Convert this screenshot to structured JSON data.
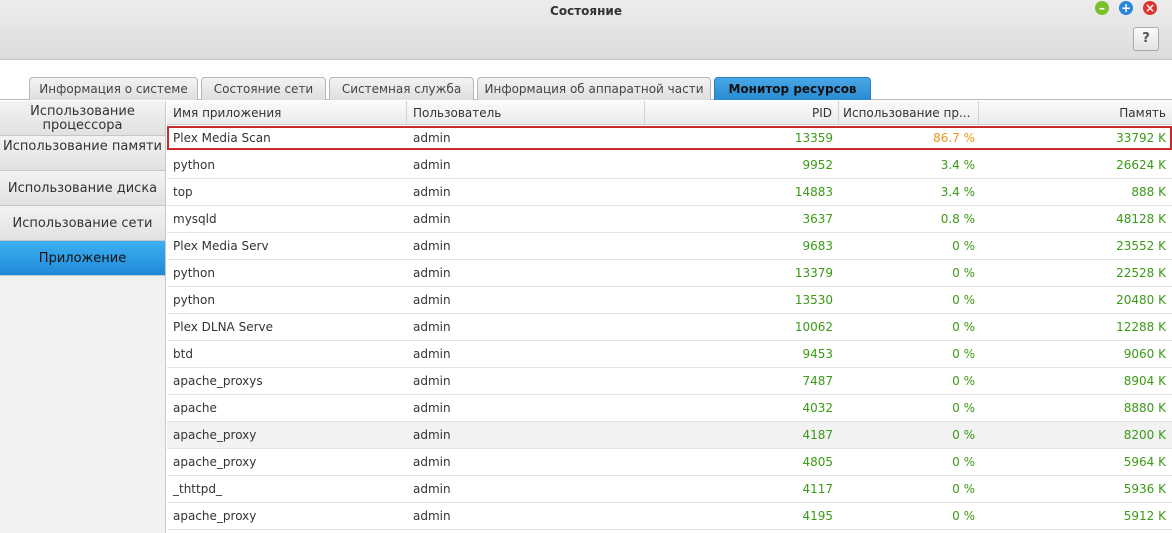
{
  "window": {
    "title": "Состояние",
    "help_label": "?",
    "controls": {
      "minimize": "–",
      "maximize": "+",
      "close": "×"
    }
  },
  "tabs": [
    {
      "label": "Информация о системе",
      "active": false
    },
    {
      "label": "Состояние сети",
      "active": false
    },
    {
      "label": "Системная служба",
      "active": false
    },
    {
      "label": "Информация об аппаратной части",
      "active": false
    },
    {
      "label": "Монитор ресурсов",
      "active": true
    }
  ],
  "sidebar": {
    "items": [
      {
        "label": "Использование процессора",
        "active": false
      },
      {
        "label": "Использование памяти",
        "active": false
      },
      {
        "label": "Использование диска",
        "active": false
      },
      {
        "label": "Использование сети",
        "active": false
      },
      {
        "label": "Приложение",
        "active": true
      }
    ]
  },
  "table": {
    "columns": {
      "name": "Имя приложения",
      "user": "Пользователь",
      "pid": "PID",
      "cpu": "Использование пр...",
      "mem": "Память"
    },
    "rows": [
      {
        "name": "Plex Media Scan",
        "user": "admin",
        "pid": "13359",
        "cpu": "86.7 %",
        "mem": "33792 K",
        "selected": true
      },
      {
        "name": "python",
        "user": "admin",
        "pid": "9952",
        "cpu": "3.4 %",
        "mem": "26624 K"
      },
      {
        "name": "top",
        "user": "admin",
        "pid": "14883",
        "cpu": "3.4 %",
        "mem": "888 K"
      },
      {
        "name": "mysqld",
        "user": "admin",
        "pid": "3637",
        "cpu": "0.8 %",
        "mem": "48128 K"
      },
      {
        "name": "Plex Media Serv",
        "user": "admin",
        "pid": "9683",
        "cpu": "0 %",
        "mem": "23552 K"
      },
      {
        "name": "python",
        "user": "admin",
        "pid": "13379",
        "cpu": "0 %",
        "mem": "22528 K"
      },
      {
        "name": "python",
        "user": "admin",
        "pid": "13530",
        "cpu": "0 %",
        "mem": "20480 K"
      },
      {
        "name": "Plex DLNA Serve",
        "user": "admin",
        "pid": "10062",
        "cpu": "0 %",
        "mem": "12288 K"
      },
      {
        "name": "btd",
        "user": "admin",
        "pid": "9453",
        "cpu": "0 %",
        "mem": "9060 K"
      },
      {
        "name": "apache_proxys",
        "user": "admin",
        "pid": "7487",
        "cpu": "0 %",
        "mem": "8904 K"
      },
      {
        "name": "apache",
        "user": "admin",
        "pid": "4032",
        "cpu": "0 %",
        "mem": "8880 K"
      },
      {
        "name": "apache_proxy",
        "user": "admin",
        "pid": "4187",
        "cpu": "0 %",
        "mem": "8200 K"
      },
      {
        "name": "apache_proxy",
        "user": "admin",
        "pid": "4805",
        "cpu": "0 %",
        "mem": "5964 K"
      },
      {
        "name": "_thttpd_",
        "user": "admin",
        "pid": "4117",
        "cpu": "0 %",
        "mem": "5936 K"
      },
      {
        "name": "apache_proxy",
        "user": "admin",
        "pid": "4195",
        "cpu": "0 %",
        "mem": "5912 K"
      }
    ]
  },
  "colors": {
    "accent": "#2a8ad2",
    "value_green": "#3b9a16",
    "cpu_high": "#e89a1b",
    "selection_border": "#cc2b2b"
  }
}
